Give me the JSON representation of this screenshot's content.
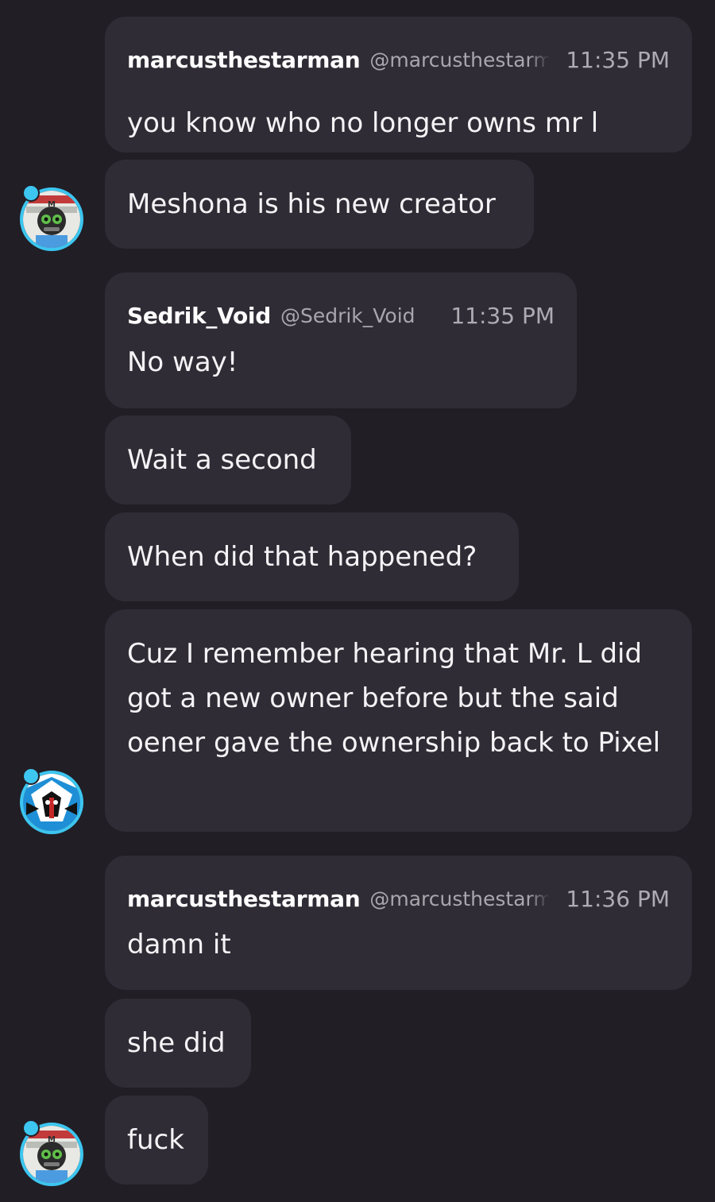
{
  "colors": {
    "background": "#211e26",
    "bubble": "#2f2c35",
    "text": "#f4f3f5",
    "muted": "#a9a6ae",
    "avatar_ring": "#3cc6f0"
  },
  "groups": [
    {
      "author": "marcusthestarman",
      "handle": "@marcusthestarman",
      "time": "11:35 PM",
      "avatar": "marcus-avatar-icon",
      "messages": [
        "you know who no longer owns mr l",
        "Meshona is his new creator"
      ]
    },
    {
      "author": "Sedrik_Void",
      "handle": "@Sedrik_Void",
      "time": "11:35 PM",
      "avatar": "sedrik-avatar-icon",
      "messages": [
        "No way!",
        "Wait a second",
        "When did that happened?",
        "Cuz I remember hearing that Mr. L did got a new owner before but the said oener gave the ownership back to Pixel"
      ]
    },
    {
      "author": "marcusthestarman",
      "handle": "@marcusthestarman",
      "time": "11:36 PM",
      "avatar": "marcus-avatar-icon",
      "messages": [
        "damn it",
        "she did",
        "fuck"
      ]
    }
  ]
}
